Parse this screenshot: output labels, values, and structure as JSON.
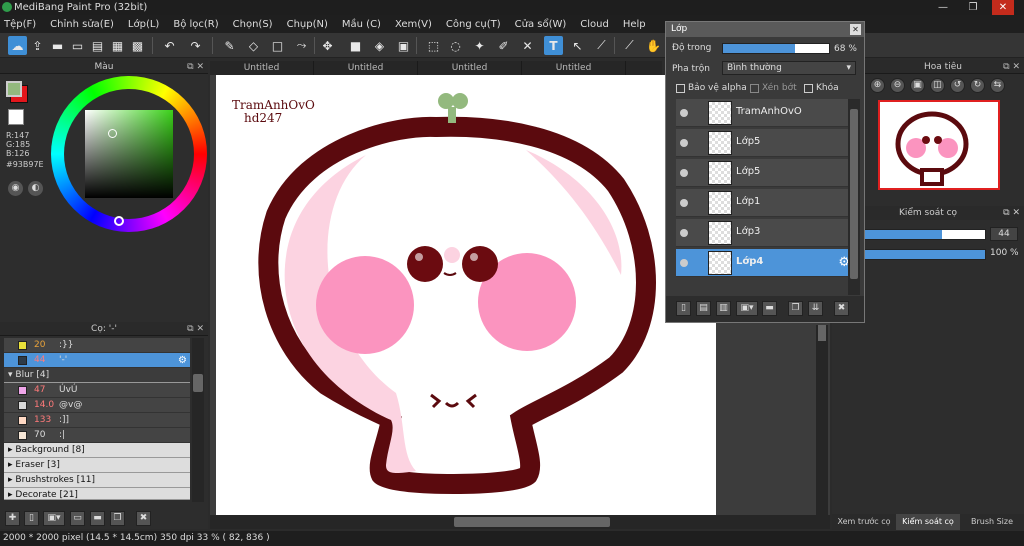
{
  "app": {
    "title": "MediBang Paint Pro (32bit)"
  },
  "window_controls": {
    "minimize": "—",
    "restore": "❐",
    "close": "✕"
  },
  "menu": [
    "Tệp(F)",
    "Chỉnh sửa(E)",
    "Lớp(L)",
    "Bộ lọc(R)",
    "Chọn(S)",
    "Chụp(N)",
    "Mầu (C)",
    "Xem(V)",
    "Công cụ(T)",
    "Cửa sổ(W)",
    "Cloud",
    "Help"
  ],
  "color_panel": {
    "title": "Màu",
    "rgb": {
      "r": "R:147",
      "g": "G:185",
      "b": "B:126"
    },
    "hex": "#93B97E",
    "primary_color": "#93B97E",
    "secondary_color": "#e3161c"
  },
  "brush_panel": {
    "title": "Cọ: '-'",
    "rows": [
      {
        "color": "#e8e03a",
        "num": "20",
        "label": ":}}"
      },
      {
        "color": "#2d3b49",
        "num": "44",
        "label": "'-'",
        "selected": true
      },
      {
        "group": "Blur [4]",
        "expanded": true
      },
      {
        "color": "#f0a6ea",
        "num": "47",
        "label": "ÚvÚ"
      },
      {
        "color": "#d9d9d9",
        "num": "14.0",
        "label": "@v@"
      },
      {
        "color": "#ffd9c4",
        "num": "133",
        "label": ":]]"
      },
      {
        "color": "#f5e6d6",
        "num": "70",
        "label": ":|"
      },
      {
        "group": "Background [8]"
      },
      {
        "group": "Eraser [3]"
      },
      {
        "group": "Brushstrokes [11]"
      },
      {
        "group": "Decorate [21]"
      }
    ]
  },
  "doc_tabs": [
    "Untitled",
    "Untitled",
    "Untitled",
    "Untitled"
  ],
  "canvas": {
    "watermark_line1": "TramAnhOvO",
    "watermark_line2": "hd247"
  },
  "layer_panel": {
    "title": "Lớp",
    "opacity_label": "Độ trong",
    "opacity_value": 68,
    "opacity_text": "68 %",
    "blend_label": "Pha trộn",
    "blend_value": "Bình thường",
    "protect_alpha": "Bảo vệ alpha",
    "clipping": "Xén bớt",
    "lock": "Khóa",
    "layers": [
      {
        "name": "TramAnhOvO"
      },
      {
        "name": "Lớp5"
      },
      {
        "name": "Lớp5"
      },
      {
        "name": "Lớp1"
      },
      {
        "name": "Lớp3"
      },
      {
        "name": "Lớp4",
        "selected": true
      }
    ]
  },
  "navigator": {
    "title": "Hoa tiêu"
  },
  "brush_control": {
    "title": "Kiểm soát cọ",
    "size_value": "44",
    "size_fill": 0.65,
    "opacity_value": "100 %",
    "opacity_fill": 1.0
  },
  "bottom_tabs": [
    "Xem trước cọ",
    "Kiểm soát cọ",
    "Brush Size"
  ],
  "status": {
    "text": "2000 * 2000 pixel   (14.5 * 14.5cm)   350 dpi   33 %   ( 82, 836 )"
  }
}
